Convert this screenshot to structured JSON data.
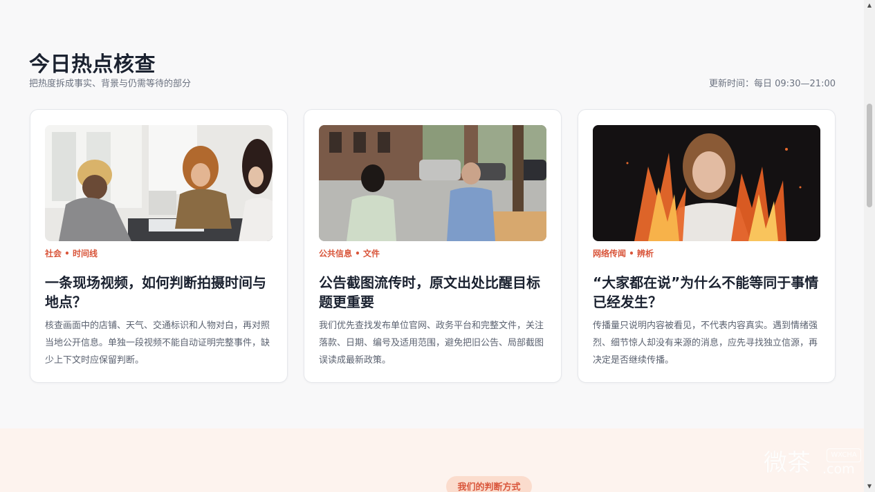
{
  "header": {
    "title": "今日热点核查",
    "subtitle": "把热度拆成事实、背景与仍需等待的部分",
    "update_time": "更新时间：每日 09:30—21:00"
  },
  "cards": [
    {
      "tag": "社会 • 时间线",
      "title": "一条现场视频，如何判断拍摄时间与地点？",
      "desc": "核查画面中的店铺、天气、交通标识和人物对白，再对照当地公开信息。单独一段视频不能自动证明完整事件，缺少上下文时应保留判断。"
    },
    {
      "tag": "公共信息 • 文件",
      "title": "公告截图流传时，原文出处比醒目标题更重要",
      "desc": "我们优先查找发布单位官网、政务平台和完整文件，关注落款、日期、编号及适用范围，避免把旧公告、局部截图误读成最新政策。"
    },
    {
      "tag": "网络传闻 • 辨析",
      "title": "“大家都在说”为什么不能等同于事情已经发生？",
      "desc": "传播量只说明内容被看见，不代表内容真实。遇到情绪强烈、细节惊人却没有来源的消息，应先寻找独立信源，再决定是否继续传播。"
    }
  ],
  "next_section": {
    "pill_label": "我们的判断方式"
  },
  "watermark": {
    "text": "微茶",
    "badge": "WXCHA",
    "suffix": ".com"
  },
  "scrollbar": {
    "up_icon": "▲",
    "down_icon": "▼"
  },
  "colors": {
    "accent": "#d9553a",
    "title": "#1b2230",
    "pill_bg": "#fbdccd",
    "bottom_bg": "#fdf3ee"
  }
}
